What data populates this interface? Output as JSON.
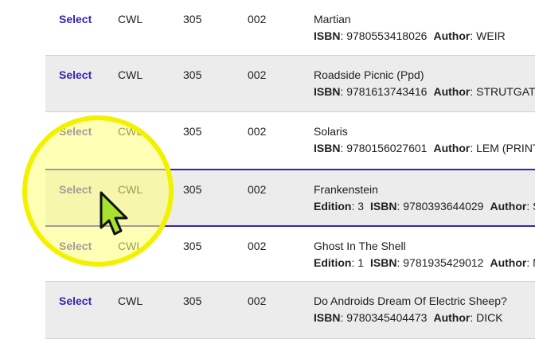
{
  "select_label": "Select",
  "labels": {
    "isbn": "ISBN",
    "author": "Author",
    "edition": "Edition"
  },
  "rows": [
    {
      "campus": "CWL",
      "dept": "305",
      "section": "002",
      "title": "Martian",
      "isbn": "9780553418026",
      "author": "WEIR"
    },
    {
      "campus": "CWL",
      "dept": "305",
      "section": "002",
      "title": "Roadside Picnic (Ppd)",
      "isbn": "9781613743416",
      "author": "STRUTGATS"
    },
    {
      "campus": "CWL",
      "dept": "305",
      "section": "002",
      "title": "Solaris",
      "isbn": "9780156027601",
      "author": "LEM (PRINT"
    },
    {
      "campus": "CWL",
      "dept": "305",
      "section": "002",
      "title": "Frankenstein",
      "edition": "3",
      "isbn": "9780393644029",
      "author": "S"
    },
    {
      "campus": "CWL",
      "dept": "305",
      "section": "002",
      "title": "Ghost In The Shell",
      "edition": "1",
      "isbn": "9781935429012",
      "author": "M"
    },
    {
      "campus": "CWL",
      "dept": "305",
      "section": "002",
      "title": "Do Androids Dream Of Electric Sheep?",
      "isbn": "9780345404473",
      "author": "DICK"
    }
  ],
  "colors": {
    "link": "#3a1fb8",
    "selected_border": "#3a1fb8",
    "alt_row": "#ececec",
    "highlight": "#f2f200",
    "cursor": "#a6e22e"
  },
  "icons": {
    "cursor": "arrow-cursor-icon",
    "highlight": "click-highlight-circle"
  }
}
